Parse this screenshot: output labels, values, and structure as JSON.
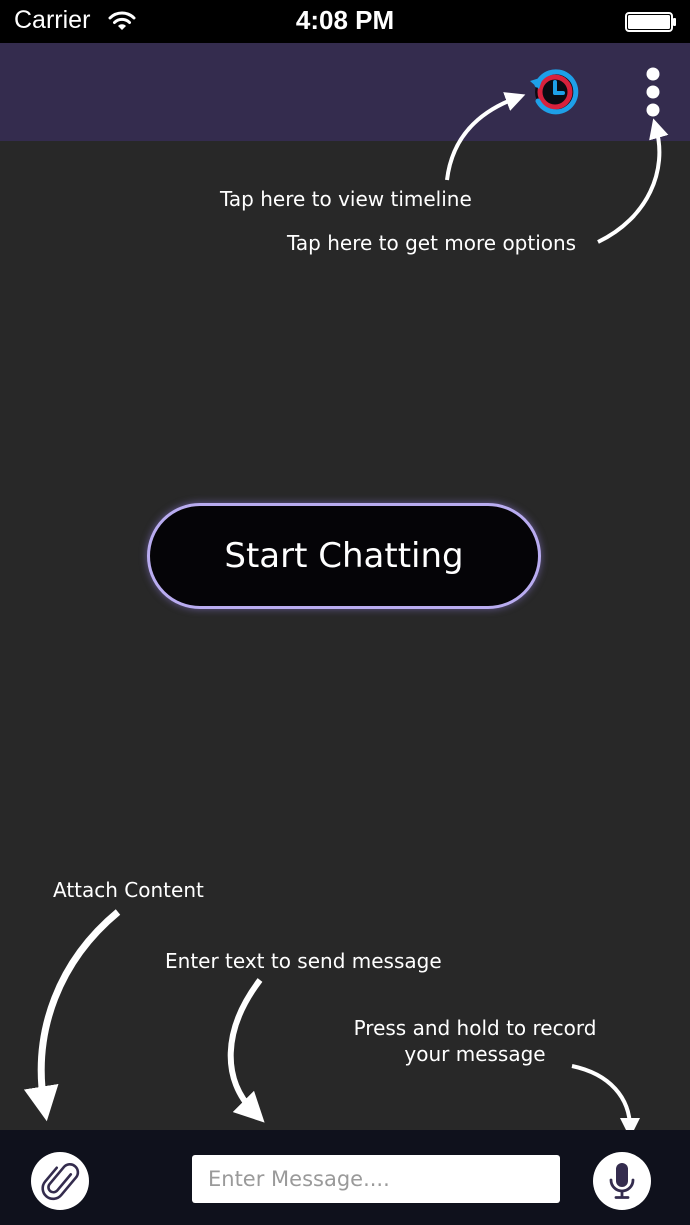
{
  "status_bar": {
    "carrier": "Carrier",
    "time": "4:08 PM",
    "wifi_icon": "wifi-icon",
    "battery_icon": "battery-full-icon"
  },
  "header": {
    "timeline_icon": "timeline-history-icon",
    "more_icon": "vertical-dots-icon"
  },
  "hints": {
    "timeline": "Tap here to view timeline",
    "more": "Tap here to get more options",
    "attach": "Attach Content",
    "enter": "Enter text to send message",
    "record": "Press and hold to record your message"
  },
  "main": {
    "start_label": "Start Chatting"
  },
  "bottom_bar": {
    "attach_icon": "paperclip-icon",
    "message_placeholder": "Enter Message....",
    "mic_icon": "microphone-icon"
  },
  "colors": {
    "status_bar": "#000000",
    "header": "#342c4e",
    "background": "#282828",
    "button_border": "#b9acf0",
    "bottom_bar": "#0f111c",
    "timeline_blue": "#1ea0e8",
    "timeline_red": "#d8213c",
    "icon_purple": "#342c4e"
  }
}
